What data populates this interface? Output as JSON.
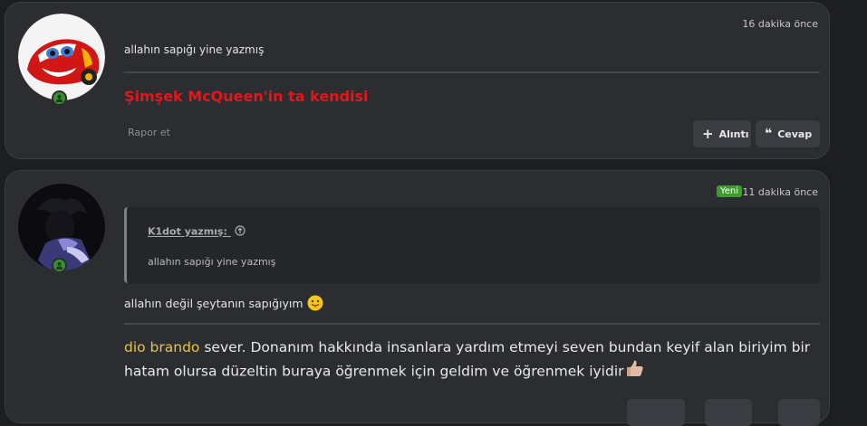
{
  "posts": [
    {
      "time": "16 dakika önce",
      "message": "allahın sapığı yine yazmış",
      "signature": "Şimşek McQueen'in ta kendisi",
      "report_label": "Rapor et",
      "quote_button": "Alıntı",
      "reply_button": "Cevap"
    },
    {
      "new_badge": "Yeni",
      "time": "11 dakika önce",
      "quote_author": "K1dot yazmış:",
      "quote_text": "allahın sapığı yine yazmış",
      "message": "allahın değil şeytanın sapığıyım",
      "signature_link": "dio brando",
      "signature_rest": " sever. Donanım hakkında insanlara yardım etmeyi seven bundan keyif alan biriyim bir hatam olursa düzeltin buraya öğrenmek için geldim ve öğrenmek iyidir"
    }
  ],
  "colors": {
    "background": "#1d1e22",
    "card": "#2b2d31",
    "signature_red": "#e3171a",
    "link_gold": "#e6c44a",
    "online_green": "#3a8f2f",
    "new_badge_green": "#3f9a31"
  },
  "icons": [
    "plus-icon",
    "quote-mark-icon",
    "online-user-icon",
    "arrow-up-circle-icon",
    "tongue-out-emoji",
    "thumbs-up-emoji"
  ]
}
